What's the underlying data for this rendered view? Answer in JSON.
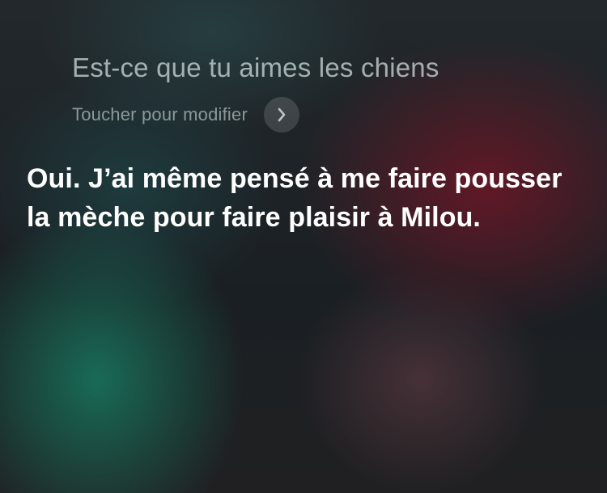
{
  "siri": {
    "query": "Est-ce que tu aimes les chiens",
    "edit_hint": "Toucher pour modifier",
    "response": "Oui. J’ai même pensé à me faire pousser la mèche pour faire plaisir à Milou."
  },
  "icons": {
    "edit_chevron": "chevron-right-icon"
  },
  "colors": {
    "query_text": "#d6e2e2",
    "response_text": "#ffffff",
    "glow_green": "#187860",
    "glow_red": "#6e1626"
  }
}
